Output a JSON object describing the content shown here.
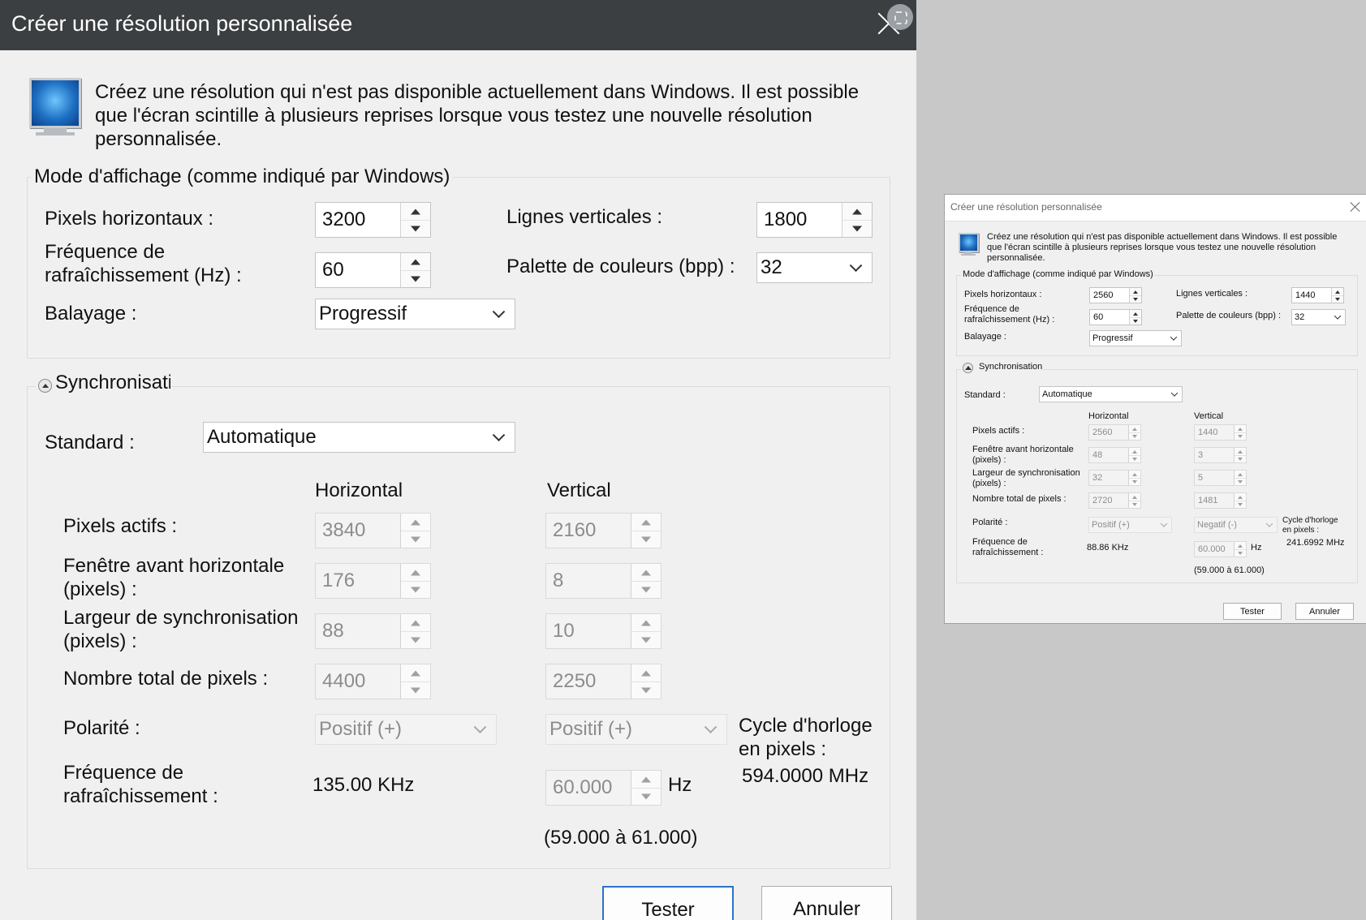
{
  "large": {
    "title": "Créer une résolution personnalisée",
    "intro": "Créez une résolution qui n'est pas disponible actuellement dans Windows. Il est possible que l'écran scintille à plusieurs reprises lorsque vous testez une nouvelle résolution personnalisée.",
    "display_mode": {
      "legend": "Mode d'affichage (comme indiqué par Windows)",
      "pixels_h_label": "Pixels horizontaux :",
      "pixels_h_value": "3200",
      "lines_v_label": "Lignes verticales :",
      "lines_v_value": "1800",
      "refresh_label": "Fréquence de rafraîchissement (Hz) :",
      "refresh_value": "60",
      "palette_label": "Palette de couleurs (bpp) :",
      "palette_value": "32",
      "scan_label": "Balayage :",
      "scan_value": "Progressif"
    },
    "sync": {
      "legend": "Synchronisati",
      "standard_label": "Standard :",
      "standard_value": "Automatique",
      "col_horizontal": "Horizontal",
      "col_vertical": "Vertical",
      "rows": [
        {
          "label": "Pixels actifs :",
          "h": "3840",
          "v": "2160"
        },
        {
          "label": "Fenêtre avant horizontale (pixels) :",
          "h": "176",
          "v": "8"
        },
        {
          "label": "Largeur de synchronisation (pixels) :",
          "h": "88",
          "v": "10"
        },
        {
          "label": "Nombre total de pixels :",
          "h": "4400",
          "v": "2250"
        }
      ],
      "polarity_label": "Polarité :",
      "polarity_h": "Positif (+)",
      "polarity_v": "Positif (+)",
      "clock_label": "Cycle d'horloge en pixels :",
      "clock_value": "594.0000 MHz",
      "refresh_label": "Fréquence de rafraîchissement :",
      "refresh_h": "135.00 KHz",
      "refresh_v": "60.000",
      "refresh_unit": "Hz",
      "refresh_range": "(59.000 à 61.000)"
    },
    "buttons": {
      "test": "Tester",
      "cancel": "Annuler"
    }
  },
  "small": {
    "title": "Créer une résolution personnalisée",
    "intro": "Créez une résolution qui n'est pas disponible actuellement dans Windows. Il est possible que l'écran scintille à plusieurs reprises lorsque vous testez une nouvelle résolution personnalisée.",
    "display_mode": {
      "legend": "Mode d'affichage (comme indiqué par Windows)",
      "pixels_h_label": "Pixels horizontaux :",
      "pixels_h_value": "2560",
      "lines_v_label": "Lignes verticales :",
      "lines_v_value": "1440",
      "refresh_label": "Fréquence de rafraîchissement (Hz) :",
      "refresh_value": "60",
      "palette_label": "Palette de couleurs (bpp) :",
      "palette_value": "32",
      "scan_label": "Balayage :",
      "scan_value": "Progressif"
    },
    "sync": {
      "legend": "Synchronisation",
      "standard_label": "Standard :",
      "standard_value": "Automatique",
      "col_horizontal": "Horizontal",
      "col_vertical": "Vertical",
      "rows": [
        {
          "label": "Pixels actifs :",
          "h": "2560",
          "v": "1440"
        },
        {
          "label": "Fenêtre avant horizontale (pixels) :",
          "h": "48",
          "v": "3"
        },
        {
          "label": "Largeur de synchronisation (pixels) :",
          "h": "32",
          "v": "5"
        },
        {
          "label": "Nombre total de pixels :",
          "h": "2720",
          "v": "1481"
        }
      ],
      "polarity_label": "Polarité :",
      "polarity_h": "Positif (+)",
      "polarity_v": "Negatif (-)",
      "clock_label": "Cycle d'horloge en pixels :",
      "clock_value": "241.6992 MHz",
      "refresh_label": "Fréquence de rafraîchissement :",
      "refresh_h": "88.86 KHz",
      "refresh_v": "60.000",
      "refresh_unit": "Hz",
      "refresh_range": "(59.000 à 61.000)"
    },
    "buttons": {
      "test": "Tester",
      "cancel": "Annuler"
    }
  }
}
